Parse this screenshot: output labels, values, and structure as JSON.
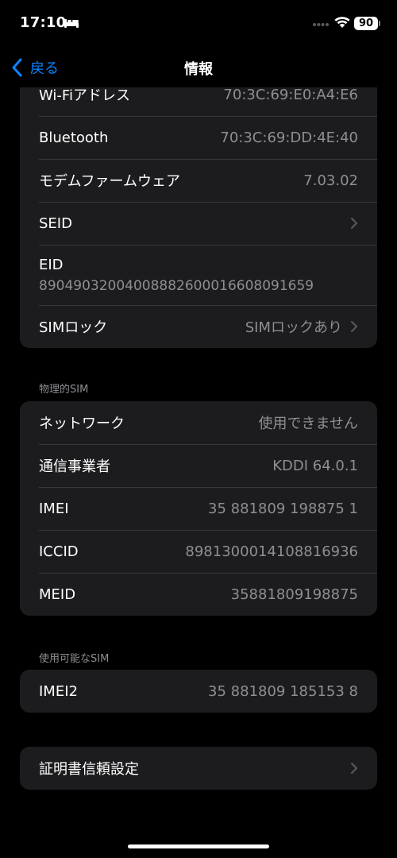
{
  "status_bar": {
    "time": "17:10",
    "battery": "90",
    "icons": [
      "bed-icon",
      "signal-dots-icon",
      "wifi-icon",
      "battery-icon"
    ]
  },
  "nav": {
    "back_label": "戻る",
    "title": "情報"
  },
  "group1": {
    "rows": [
      {
        "label": "Wi-Fiアドレス",
        "value": "70:3C:69:E0:A4:E6"
      },
      {
        "label": "Bluetooth",
        "value": "70:3C:69:DD:4E:40"
      },
      {
        "label": "モデムファームウェア",
        "value": "7.03.02"
      },
      {
        "label": "SEID",
        "value": ""
      },
      {
        "label": "EID",
        "value": "89049032004008882600016608091659"
      },
      {
        "label": "SIMロック",
        "value": "SIMロックあり"
      }
    ]
  },
  "physical_sim": {
    "header": "物理的SIM",
    "rows": [
      {
        "label": "ネットワーク",
        "value": "使用できません"
      },
      {
        "label": "通信事業者",
        "value": "KDDI 64.0.1"
      },
      {
        "label": "IMEI",
        "value": "35 881809 198875 1"
      },
      {
        "label": "ICCID",
        "value": "8981300014108816936"
      },
      {
        "label": "MEID",
        "value": "35881809198875"
      }
    ]
  },
  "available_sim": {
    "header": "使用可能なSIM",
    "rows": [
      {
        "label": "IMEI2",
        "value": "35 881809 185153 8"
      }
    ]
  },
  "certificate": {
    "label": "証明書信頼設定"
  },
  "colors": {
    "accent": "#0a84ff",
    "cell_background": "#1c1c1e",
    "secondary_text": "#8e8e93"
  }
}
